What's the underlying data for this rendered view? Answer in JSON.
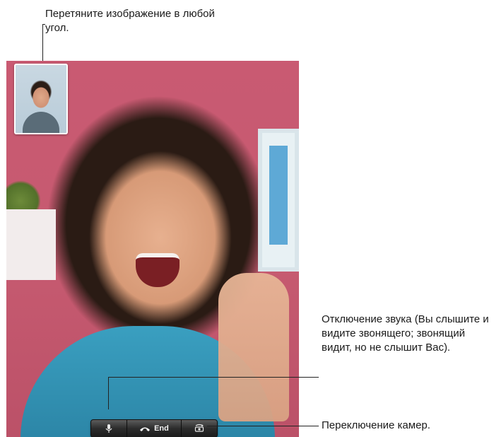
{
  "annotations": {
    "drag_hint": "Перетяните изображение в любой угол.",
    "mute_desc": "Отключение звука (Вы слышите и видите звонящего; звонящий видит, но не слышит Вас).",
    "switch_camera_desc": "Переключение камер."
  },
  "call": {
    "toolbar": {
      "mute_icon": "microphone-icon",
      "end_label": "End",
      "end_icon": "phone-hangup-icon",
      "switch_icon": "camera-switch-icon"
    }
  }
}
